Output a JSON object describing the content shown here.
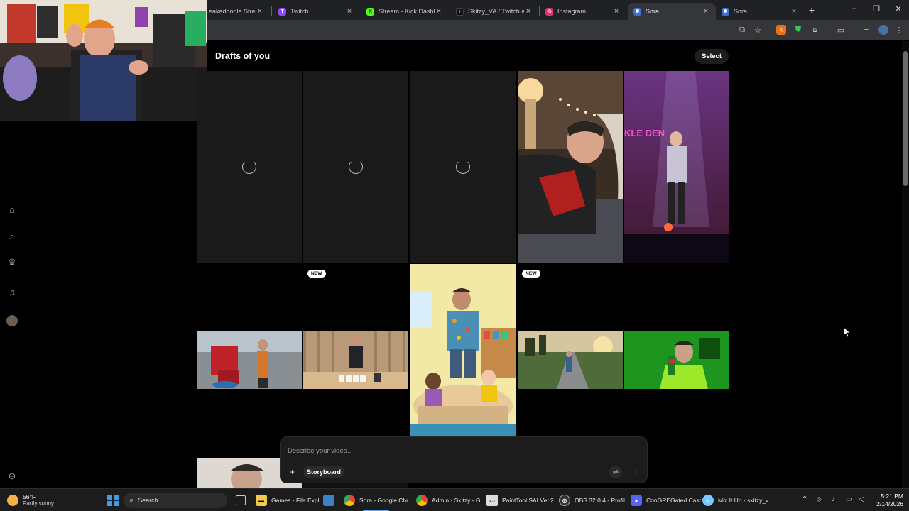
{
  "browser": {
    "tabs": [
      {
        "label": "eakadoodle Stream",
        "fav_color": "#6b4ce6",
        "fav": ""
      },
      {
        "label": "Twitch",
        "fav_color": "#9146ff",
        "fav": "T"
      },
      {
        "label": "Stream - Kick Dashbo",
        "fav_color": "#53fc18",
        "fav": "K"
      },
      {
        "label": "Skitzy_VA / Twitch an",
        "fav_color": "#111111",
        "fav": "♪"
      },
      {
        "label": "Instagram",
        "fav_color": "#e1306c",
        "fav": "◎"
      },
      {
        "label": "Sora",
        "fav_color": "#3c6fd8",
        "fav": "✺"
      },
      {
        "label": "Sora",
        "fav_color": "#3c6fd8",
        "fav": "✺"
      }
    ],
    "new_tab_label": "+",
    "window_controls": [
      "–",
      "❐",
      "✕"
    ]
  },
  "page": {
    "title": "Drafts of you",
    "select_button": "Select",
    "badge_label": "NEW"
  },
  "grid": {
    "row1": [
      {
        "kind": "loading"
      },
      {
        "kind": "loading"
      },
      {
        "kind": "loading"
      },
      {
        "kind": "image",
        "scene": "man-sleeping-with-chips"
      },
      {
        "kind": "image",
        "scene": "comedian-on-stage",
        "sign_text": "KLE DEN"
      }
    ],
    "row2": [
      {
        "kind": "image",
        "scene": "woodchipper-on-dock"
      },
      {
        "kind": "image",
        "scene": "man-with-cups-in-yard"
      },
      {
        "kind": "image",
        "scene": "teacher-in-classroom"
      },
      {
        "kind": "image",
        "scene": "man-on-park-path"
      },
      {
        "kind": "image",
        "scene": "man-with-green-soda"
      }
    ]
  },
  "prompt": {
    "placeholder": "Describe your video...",
    "add_icon": "+",
    "storyboard_label": "Storyboard"
  },
  "taskbar": {
    "weather_temp": "56°F",
    "weather_desc": "Partly sunny",
    "search_label": "Search",
    "apps": [
      {
        "label": "Games - File Expl",
        "color": "#f2c94c",
        "icon": "▬"
      },
      {
        "label": "Sora - Google Chr",
        "color": "#4285f4",
        "icon": "◉"
      },
      {
        "label": "Admin - Skitzy - G",
        "color": "#4285f4",
        "icon": "◉"
      },
      {
        "label": "PaintTool SAI Ver.2",
        "color": "#dddddd",
        "icon": "▭"
      },
      {
        "label": "OBS 32.0.4 - Profil",
        "color": "#333333",
        "icon": "◎"
      },
      {
        "label": "ConGREGated Cast",
        "color": "#5865f2",
        "icon": "●"
      },
      {
        "label": "Mix It Up - skitzy_v",
        "color": "#7cc8ff",
        "icon": "◐"
      }
    ],
    "time": "5:21 PM",
    "date": "2/14/2026"
  }
}
